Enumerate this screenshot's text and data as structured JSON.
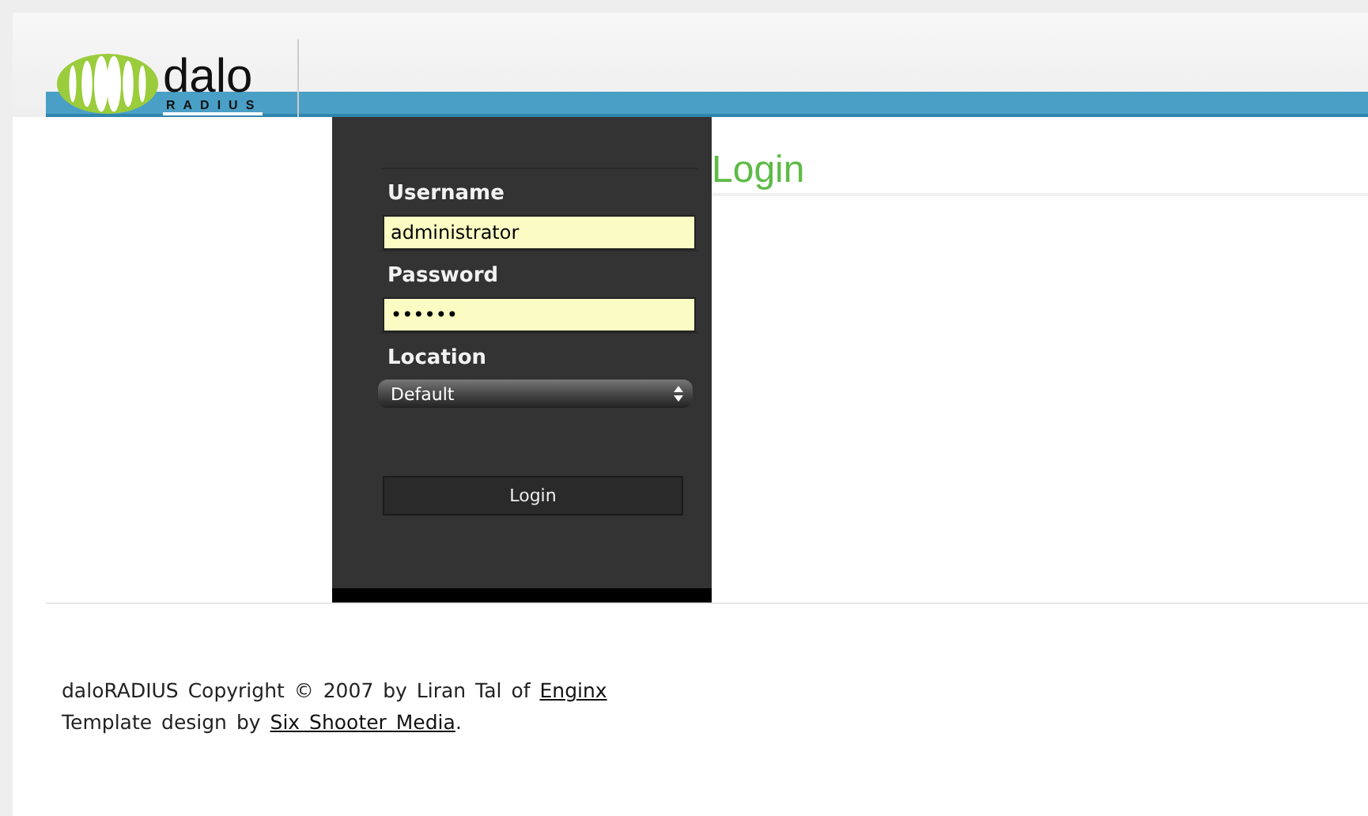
{
  "logo": {
    "word": "dalo",
    "subword": "RADIUS"
  },
  "heading": "Login",
  "form": {
    "fields": [
      {
        "kind": "text",
        "label": "Username",
        "value": "administrator"
      },
      {
        "kind": "password",
        "label": "Password",
        "value": "••••••"
      },
      {
        "kind": "select",
        "label": "Location",
        "value": "Default"
      }
    ],
    "submit": "Login"
  },
  "footer": [
    {
      "prefix": "daloRADIUS Copyright © 2007 by Liran Tal of ",
      "link": "Enginx"
    },
    {
      "prefix": "Template design by ",
      "link": "Six Shooter Media",
      "suffix": "."
    }
  ]
}
